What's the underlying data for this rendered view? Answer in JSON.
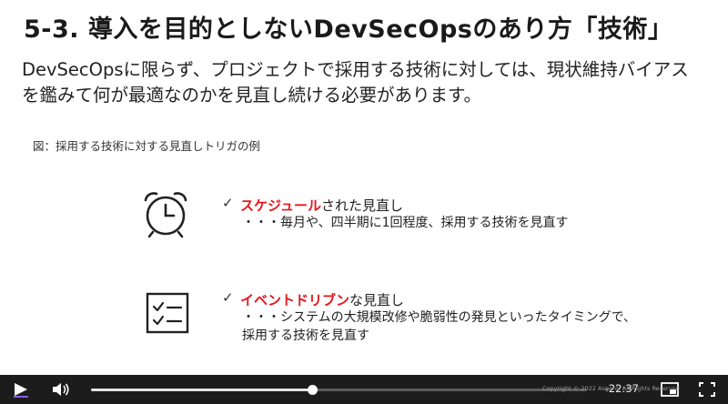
{
  "slide": {
    "title": "5-3. 導入を目的としないDevSecOpsのあり方「技術」",
    "subtitle_line1": "DevSecOpsに限らず、プロジェクトで採用する技術に対しては、現状維持バイアス",
    "subtitle_line2": "を鑑みて何が最適なのかを見直し続ける必要があります。",
    "figure_caption": "図：採用する技術に対する見直しトリガの例",
    "items": [
      {
        "icon": "alarm-clock-icon",
        "check": "✓",
        "accent": "スケジュール",
        "heading_rest": "された見直し",
        "desc_line1": "・・・毎月や、四半期に1回程度、採用する技術を見直す",
        "desc_line2": ""
      },
      {
        "icon": "checklist-icon",
        "check": "✓",
        "accent": "イベントドリブン",
        "heading_rest": "な見直し",
        "desc_line1": "・・・システムの大規模改修や脆弱性の発見といったタイミングで、",
        "desc_line2": "採用する技術を見直す"
      }
    ],
    "accent_color": "#e8151b"
  },
  "player": {
    "time_remaining": "-22:37",
    "progress": 0.445,
    "watermark": "Copyright © 2022 Asgent, All Rights Reserved"
  }
}
